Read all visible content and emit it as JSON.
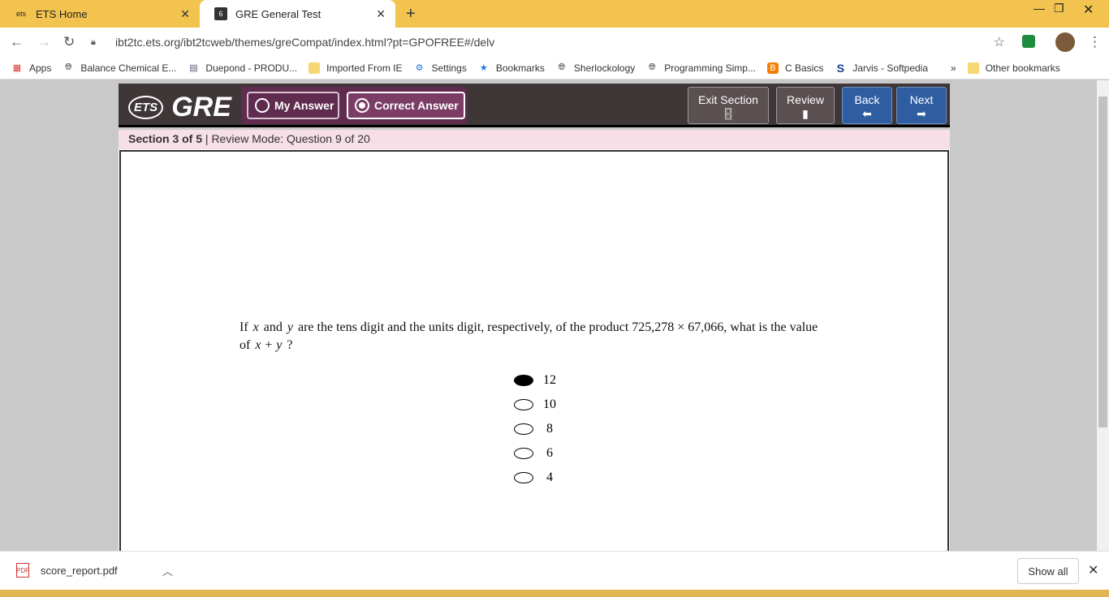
{
  "browser": {
    "tabs": [
      {
        "title": "ETS Home",
        "active": false
      },
      {
        "title": "GRE General Test",
        "active": true
      }
    ],
    "url": "ibt2tc.ets.org/ibt2tcweb/themes/greCompat/index.html?pt=GPOFREE#/delv",
    "bookmarks": [
      {
        "label": "Apps",
        "icon": "apps-grid-icon"
      },
      {
        "label": "Balance Chemical E...",
        "icon": "globe-icon"
      },
      {
        "label": "Duepond - PRODU...",
        "icon": "doc-icon"
      },
      {
        "label": "Imported From IE",
        "icon": "folder-icon"
      },
      {
        "label": "Settings",
        "icon": "gear-icon"
      },
      {
        "label": "Bookmarks",
        "icon": "star-icon"
      },
      {
        "label": "Sherlockology",
        "icon": "globe-icon"
      },
      {
        "label": "Programming Simp...",
        "icon": "globe-icon"
      },
      {
        "label": "C Basics",
        "icon": "blogger-icon"
      },
      {
        "label": "Jarvis - Softpedia",
        "icon": "softpedia-icon"
      }
    ],
    "more_bookmarks": "»",
    "other_bookmarks": "Other bookmarks"
  },
  "gre": {
    "logo_ets": "ETS",
    "logo_gre": "GRE",
    "my_answer": "My Answer",
    "correct_answer": "Correct Answer",
    "exit_section": "Exit Section",
    "review": "Review",
    "back": "Back",
    "next": "Next",
    "section_bold": "Section 3 of 5",
    "section_rest": " | Review Mode: Question 9 of 20"
  },
  "question": {
    "part1": "If",
    "var_x": "x",
    "part2": "and",
    "var_y": "y",
    "part3": "are the tens digit and the units digit, respectively, of the product",
    "product": "725,278 × 67,066,",
    "part4": "what is the value of",
    "expr": "x + y",
    "part5": "?",
    "choices": [
      {
        "label": "12",
        "selected": true
      },
      {
        "label": "10",
        "selected": false
      },
      {
        "label": "8",
        "selected": false
      },
      {
        "label": "6",
        "selected": false
      },
      {
        "label": "4",
        "selected": false
      }
    ]
  },
  "downloads": {
    "file": "score_report.pdf",
    "show_all": "Show all"
  },
  "colors": {
    "tabbar": "#f2c44f",
    "gre_header": "#3f3637",
    "answer_group": "#5f2b4e",
    "nav_blue": "#2e5ea1",
    "section_bar": "#f6dfe6"
  }
}
